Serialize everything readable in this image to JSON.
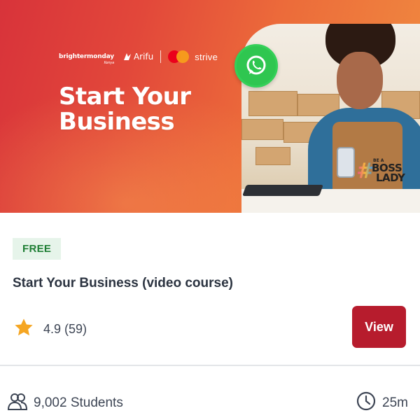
{
  "banner": {
    "partners": {
      "brightermonday": "brightermonday",
      "brightermonday_sub": "Kenya",
      "arifu": "Arifu",
      "strive": "strive"
    },
    "headline_line1": "Start Your",
    "headline_line2": "Business",
    "hashtag_small": "BE A",
    "hashtag_word1": "BOSS",
    "hashtag_word2": "LADY",
    "hashtag_symbol": "#"
  },
  "course": {
    "badge": "FREE",
    "title": "Start Your Business (video course)",
    "rating": "4.9 (59)",
    "view_label": "View",
    "students": "9,002 Students",
    "duration": "25m"
  },
  "colors": {
    "accent": "#b71c2d",
    "badge_bg": "#e6f4ea",
    "badge_text": "#1e7e34",
    "star": "#f5a623",
    "whatsapp": "#2fc650"
  },
  "icons": [
    "whatsapp-icon",
    "star-icon",
    "users-icon",
    "clock-icon",
    "mastercard-logo",
    "arifu-logo"
  ]
}
